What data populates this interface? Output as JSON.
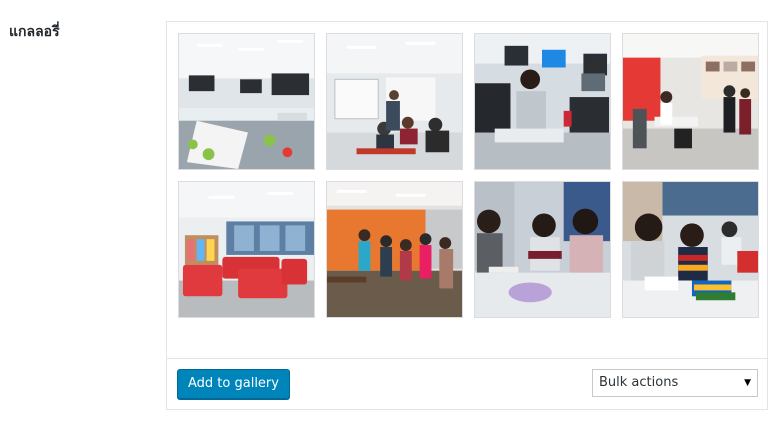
{
  "field": {
    "label": "แกลลอรี่"
  },
  "gallery": {
    "images": [
      {
        "name": "gallery-thumb-empty-classroom"
      },
      {
        "name": "gallery-thumb-lecture-room"
      },
      {
        "name": "gallery-thumb-computer-lab"
      },
      {
        "name": "gallery-thumb-student-lounge-kitchen"
      },
      {
        "name": "gallery-thumb-red-sofa-lounge"
      },
      {
        "name": "gallery-thumb-orange-wall-group"
      },
      {
        "name": "gallery-thumb-students-clapping"
      },
      {
        "name": "gallery-thumb-students-studying"
      }
    ]
  },
  "footer": {
    "add_button_label": "Add to gallery",
    "bulk_actions": {
      "selected": "Bulk actions",
      "arrow_icon": "triangle-down-icon"
    }
  },
  "colors": {
    "primary": "#0085ba",
    "border": "#e2e4e7"
  }
}
